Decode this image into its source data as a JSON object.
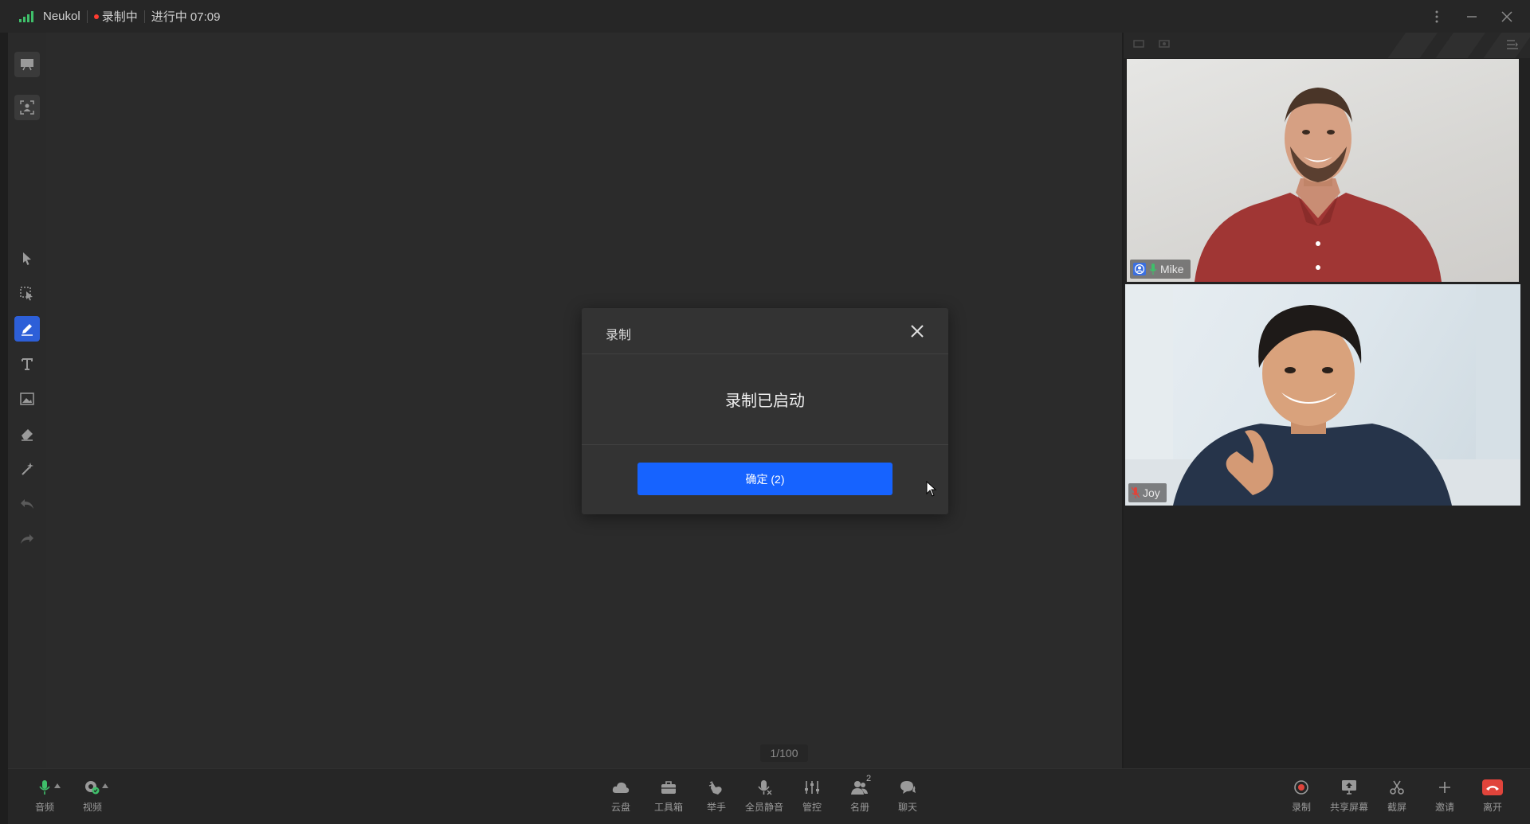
{
  "titlebar": {
    "app_name": "Neukol",
    "recording_label": "录制中",
    "elapsed": "进行中 07:09"
  },
  "dialog": {
    "title": "录制",
    "message": "录制已启动",
    "confirm_label": "确定 (2)"
  },
  "canvas": {
    "page_indicator": "1/100"
  },
  "participants": [
    {
      "name": "Mike"
    },
    {
      "name": "Joy"
    }
  ],
  "bottom": {
    "audio_label": "音频",
    "video_label": "视频",
    "cloud_label": "云盘",
    "toolbox_label": "工具箱",
    "raise_hand_label": "举手",
    "mute_all_label": "全员静音",
    "control_label": "管控",
    "roster_label": "名册",
    "roster_count": "2",
    "chat_label": "聊天",
    "record_label": "录制",
    "share_screen_label": "共享屏幕",
    "screenshot_label": "截屏",
    "invite_label": "邀请",
    "leave_label": "离开"
  },
  "colors": {
    "accent_blue": "#1663ff",
    "active_tool": "#2d5fd8",
    "recording_red": "#ff3b30",
    "leave_red": "#e0443b",
    "signal_green": "#3fbf6a"
  }
}
